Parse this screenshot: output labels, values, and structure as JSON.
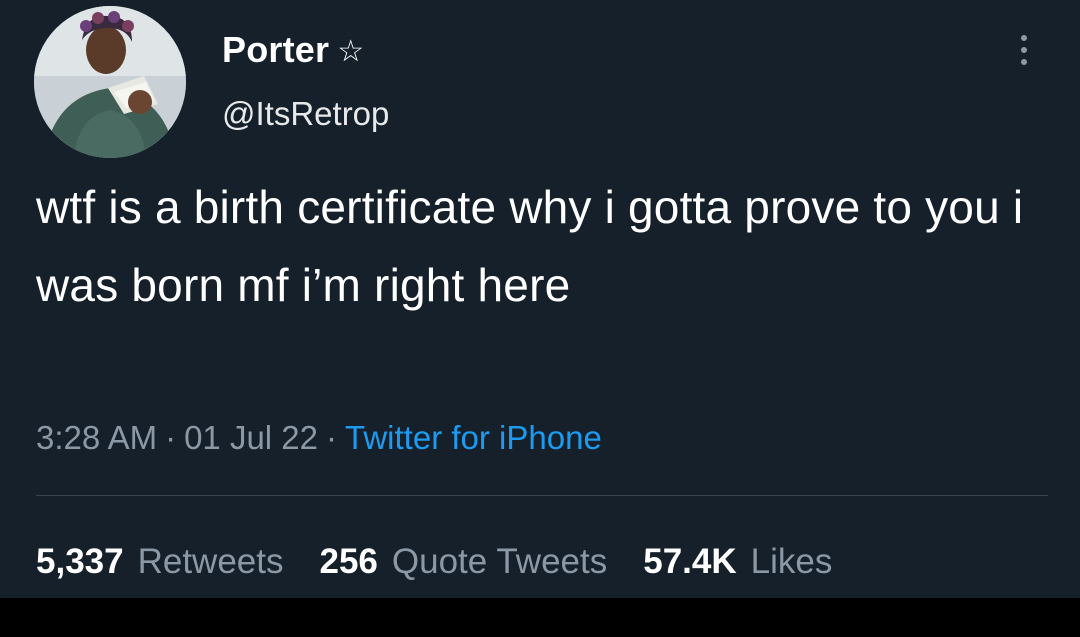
{
  "user": {
    "display_name": "Porter",
    "name_emoji": "☆",
    "handle": "@ItsRetrop"
  },
  "tweet": {
    "text": "wtf is a birth certificate why i gotta prove to you i was born mf i’m right here"
  },
  "meta": {
    "time": "3:28 AM",
    "separator": "·",
    "date": "01 Jul 22",
    "source": "Twitter for iPhone"
  },
  "stats": {
    "retweets_count": "5,337",
    "retweets_label": "Retweets",
    "quotes_count": "256",
    "quotes_label": "Quote Tweets",
    "likes_count": "57.4K",
    "likes_label": "Likes"
  },
  "colors": {
    "background": "#15202b",
    "primary_text": "#ffffff",
    "secondary_text": "#8b98a5",
    "link": "#1d9bf0",
    "divider": "#38444d"
  },
  "icons": {
    "more": "more-vertical-icon",
    "star": "star-outline-icon",
    "avatar": "profile-photo"
  }
}
